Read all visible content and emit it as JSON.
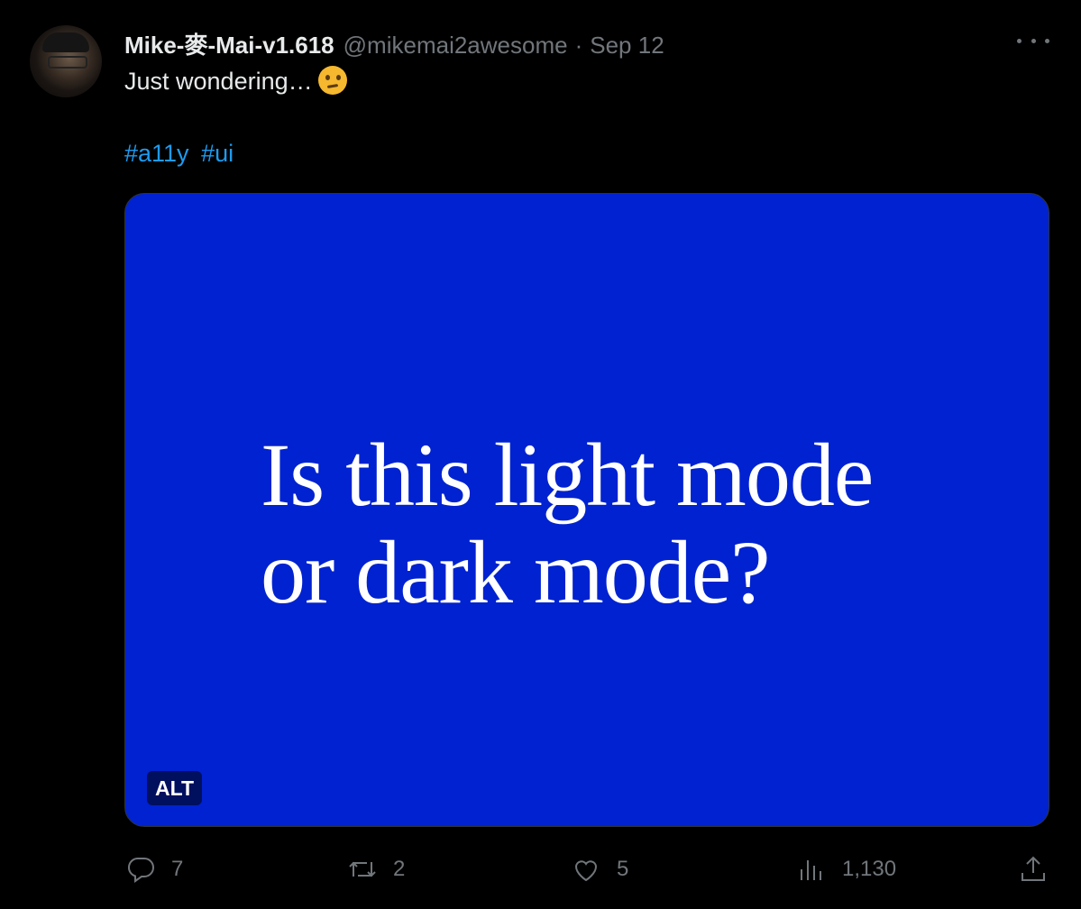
{
  "tweet": {
    "author_name": "Mike-麥-Mai-v1.618",
    "handle": "@mikemai2awesome",
    "separator": "·",
    "date": "Sep 12",
    "text": "Just wondering…",
    "emoji": "thinking-face",
    "hashtags": [
      "#a11y",
      "#ui"
    ]
  },
  "media": {
    "background_color": "#0022d0",
    "line1": "Is this light mode",
    "line2": "or dark mode?",
    "alt_badge": "ALT"
  },
  "actions": {
    "replies": "7",
    "reposts": "2",
    "likes": "5",
    "views": "1,130"
  },
  "colors": {
    "background": "#000000",
    "text": "#e7e9ea",
    "muted": "#71767b",
    "link": "#1d9bf0"
  }
}
